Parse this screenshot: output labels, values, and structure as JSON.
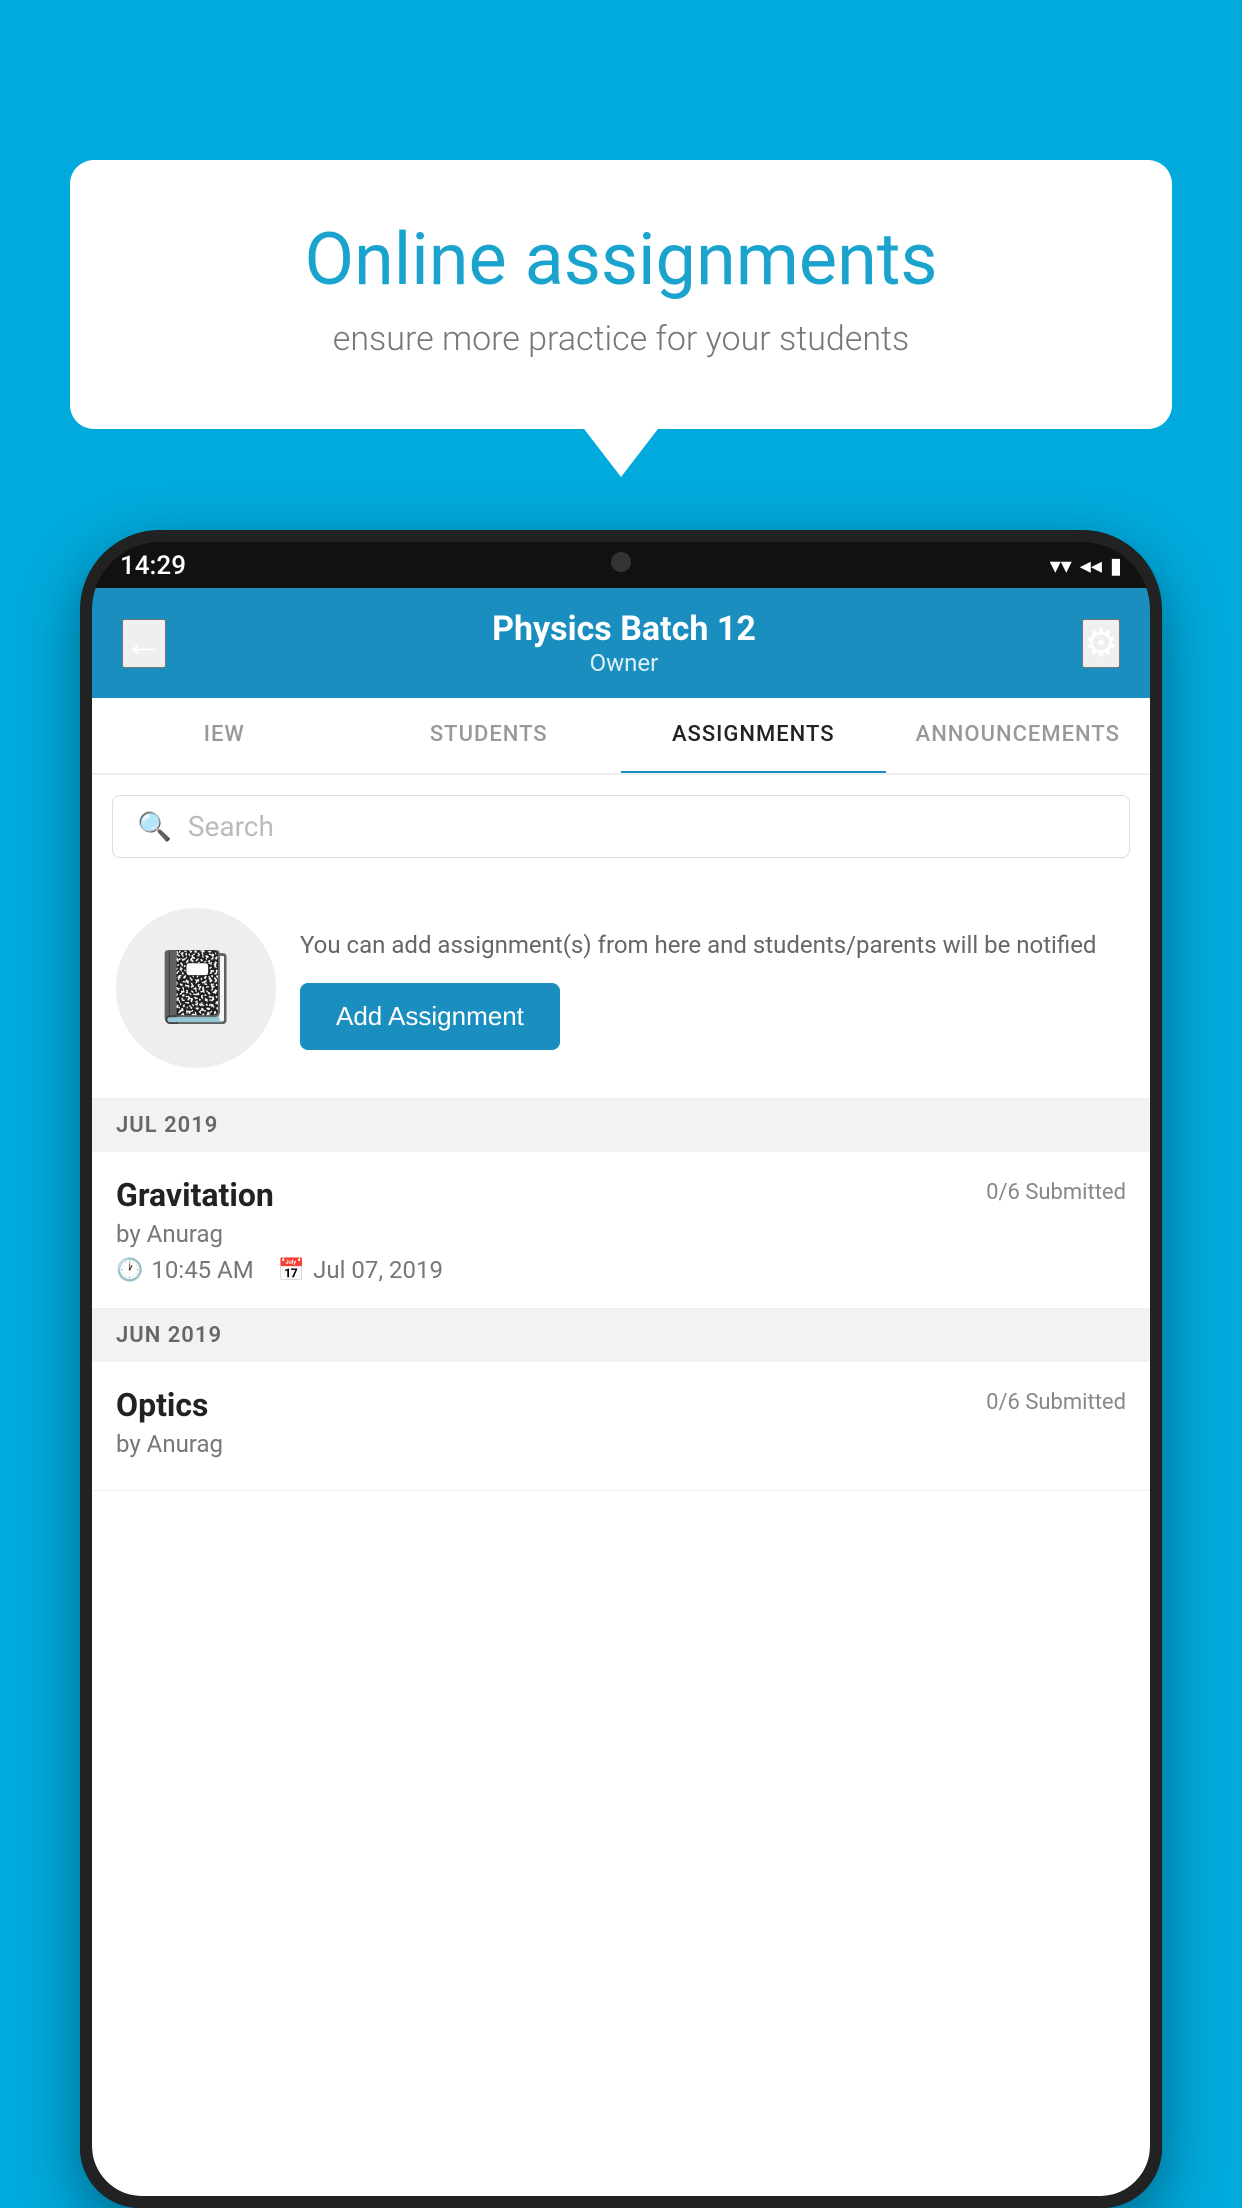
{
  "background_color": "#00AADD",
  "speech_bubble": {
    "title": "Online assignments",
    "subtitle": "ensure more practice for your students"
  },
  "status_bar": {
    "time": "14:29",
    "wifi_icon": "▲",
    "signal_icon": "◀",
    "battery_icon": "▮"
  },
  "toolbar": {
    "back_icon": "←",
    "title": "Physics Batch 12",
    "subtitle": "Owner",
    "settings_icon": "⚙"
  },
  "tabs": [
    {
      "id": "iew",
      "label": "IEW",
      "active": false
    },
    {
      "id": "students",
      "label": "STUDENTS",
      "active": false
    },
    {
      "id": "assignments",
      "label": "ASSIGNMENTS",
      "active": true
    },
    {
      "id": "announcements",
      "label": "ANNOUNCEMENTS",
      "active": false
    }
  ],
  "search": {
    "placeholder": "Search",
    "search_icon": "🔍"
  },
  "add_assignment": {
    "description": "You can add assignment(s) from here and students/parents will be notified",
    "button_label": "Add Assignment"
  },
  "sections": [
    {
      "header": "JUL 2019",
      "items": [
        {
          "name": "Gravitation",
          "submitted": "0/6 Submitted",
          "by": "by Anurag",
          "time": "10:45 AM",
          "date": "Jul 07, 2019"
        }
      ]
    },
    {
      "header": "JUN 2019",
      "items": [
        {
          "name": "Optics",
          "submitted": "0/6 Submitted",
          "by": "by Anurag",
          "time": "",
          "date": ""
        }
      ]
    }
  ]
}
